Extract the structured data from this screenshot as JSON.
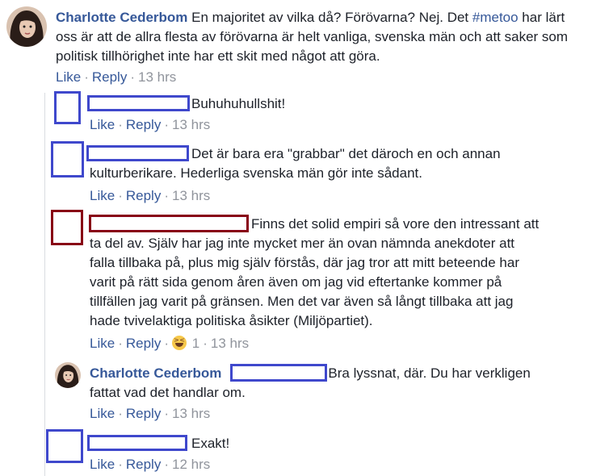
{
  "main_comment": {
    "author": "Charlotte Cederbom",
    "text_prefix": "En majoritet av vilka då? Förövarna? Nej. Det ",
    "hashtag": "#metoo",
    "text_suffix": " har lärt oss är att de allra flesta av förövarna är helt vanliga, svenska män och att saker som politisk tillhörighet inte har ett skit med något att göra.",
    "like": "Like",
    "reply": "Reply",
    "time": "13 hrs"
  },
  "replies": [
    {
      "text": "Buhuhuhullshit!",
      "like": "Like",
      "reply": "Reply",
      "time": "13 hrs"
    },
    {
      "text": "Det är bara era \"grabbar\" det däroch en och annan kulturberikare. Hederliga svenska män gör inte sådant.",
      "like": "Like",
      "reply": "Reply",
      "time": "13 hrs"
    },
    {
      "text": "Finns det solid empiri så vore den intressant att ta del av. Själv har jag inte mycket mer än ovan nämnda anekdoter att falla tillbaka på, plus mig själv förstås, där jag tror att mitt beteende har varit på rätt sida genom åren även om jag vid eftertanke kommer på tillfällen jag varit på gränsen. Men det var även så långt tillbaka att jag hade tvivelaktiga politiska åsikter (Miljöpartiet).",
      "like": "Like",
      "reply": "Reply",
      "reaction_count": "1",
      "time": "13 hrs"
    },
    {
      "author": "Charlotte Cederbom",
      "text": "Bra lyssnat, där. Du har verkligen fattat vad det handlar om.",
      "like": "Like",
      "reply": "Reply",
      "time": "13 hrs"
    },
    {
      "text": "Exakt!",
      "like": "Like",
      "reply": "Reply",
      "time": "12 hrs"
    }
  ],
  "icons": {
    "reaction": "haha-emoji-icon"
  }
}
